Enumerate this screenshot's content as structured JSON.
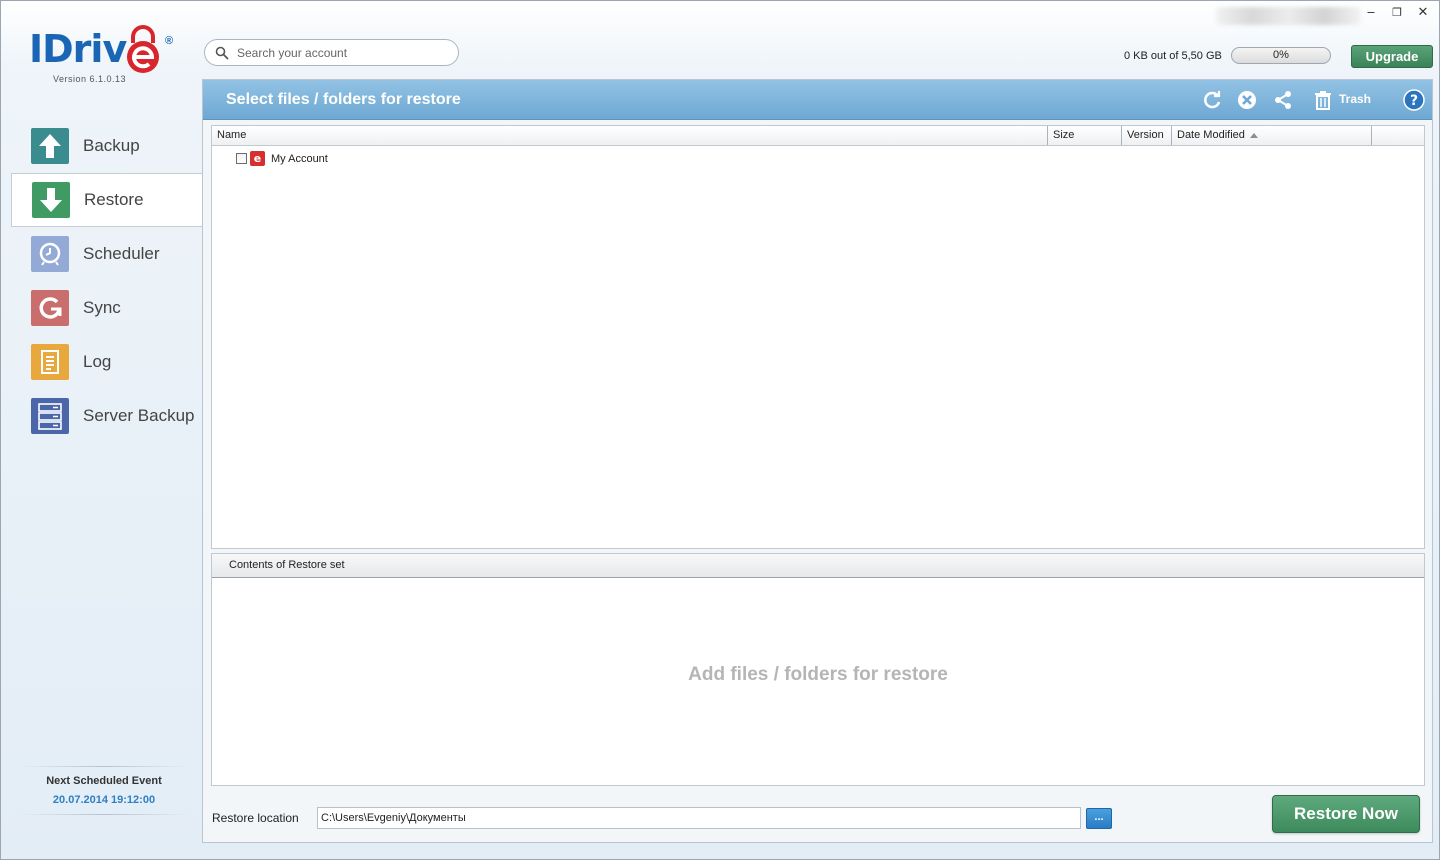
{
  "app": {
    "brand": "IDrive",
    "version": "Version  6.1.0.13"
  },
  "window": {
    "minimize": "‒",
    "restore": "❐",
    "close": "✕"
  },
  "search": {
    "placeholder": "Search your account"
  },
  "quota": {
    "text": "0 KB out of 5,50 GB",
    "percent_label": "0%",
    "percent": 0
  },
  "upgrade_label": "Upgrade",
  "sidebar": {
    "items": [
      {
        "label": "Backup",
        "icon": "backup-arrow-up-icon",
        "color": "#3a8a8c"
      },
      {
        "label": "Restore",
        "icon": "restore-arrow-down-icon",
        "color": "#3d9a63"
      },
      {
        "label": "Scheduler",
        "icon": "scheduler-clock-icon",
        "color": "#8fa8d6"
      },
      {
        "label": "Sync",
        "icon": "sync-icon",
        "color": "#c56a6a"
      },
      {
        "label": "Log",
        "icon": "log-document-icon",
        "color": "#e8a63a"
      },
      {
        "label": "Server Backup",
        "icon": "server-backup-icon",
        "color": "#4a64a8"
      }
    ],
    "active_index": 1
  },
  "next_event": {
    "title": "Next Scheduled Event",
    "date": "20.07.2014 19:12:00"
  },
  "panel": {
    "title": "Select files / folders for restore",
    "trash_label": "Trash"
  },
  "table": {
    "columns": [
      "Name",
      "Size",
      "Version",
      "Date Modified"
    ],
    "rows": [
      {
        "name": "My Account",
        "checked": false
      }
    ]
  },
  "restore_set": {
    "header": "Contents of Restore set",
    "placeholder": "Add files / folders for restore"
  },
  "restore_location": {
    "label": "Restore location",
    "value": "C:\\Users\\Evgeniy\\Документы",
    "browse_label": "..."
  },
  "restore_now_label": "Restore Now"
}
